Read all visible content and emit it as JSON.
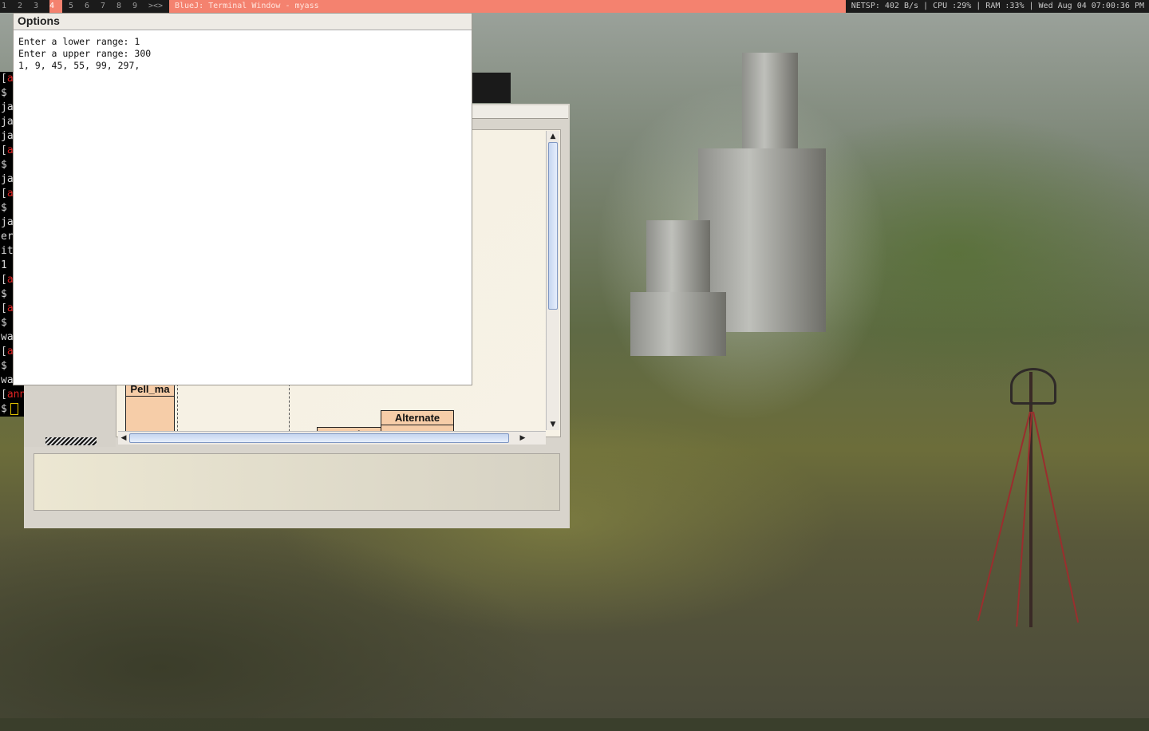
{
  "topbar": {
    "workspaces": [
      "1",
      "2",
      "3",
      "4",
      "5",
      "6",
      "7",
      "8",
      "9",
      "><>"
    ],
    "active_workspace": "4",
    "window_title": "BlueJ: Terminal Window - myass",
    "system_info": "NETSP: 402 B/s | CPU :29% | RAM :33% | Wed Aug 04 07:00:36 PM",
    "accent_color": "#f4826f"
  },
  "terminal": {
    "lines": [
      {
        "prefix": "[",
        "red": "a"
      },
      {
        "prefix": "$",
        "red": ""
      },
      {
        "prefix": "ja",
        "red": ""
      },
      {
        "prefix": "ja",
        "red": ""
      },
      {
        "prefix": "ja",
        "red": ""
      },
      {
        "prefix": "[",
        "red": "a"
      },
      {
        "prefix": "$",
        "red": ""
      },
      {
        "prefix": "ja",
        "red": ""
      },
      {
        "prefix": "[",
        "red": "a"
      },
      {
        "prefix": "$",
        "red": ""
      },
      {
        "prefix": "ja",
        "red": ""
      },
      {
        "prefix": "er",
        "red": ""
      },
      {
        "prefix": "it",
        "red": ""
      },
      {
        "prefix": "1",
        "red": ""
      },
      {
        "prefix": "[",
        "red": "a"
      },
      {
        "prefix": "$",
        "red": ""
      },
      {
        "prefix": "[",
        "red": "a"
      },
      {
        "prefix": "$",
        "red": ""
      },
      {
        "prefix": "wa",
        "red": ""
      },
      {
        "prefix": "[",
        "red": "a"
      },
      {
        "prefix": "$",
        "red": ""
      },
      {
        "prefix": "wa",
        "red": ""
      },
      {
        "prefix": "[",
        "red": "ann"
      },
      {
        "prefix": "$",
        "red": ""
      }
    ]
  },
  "options_window": {
    "title": "Options",
    "output": [
      "Enter a lower range: 1",
      "Enter a upper range: 300",
      "1, 9, 45, 55, 99, 297,"
    ]
  },
  "bluej": {
    "classes": {
      "pell": "Pell_ma",
      "alternate": "Alternate",
      "partial": "Od..."
    }
  }
}
